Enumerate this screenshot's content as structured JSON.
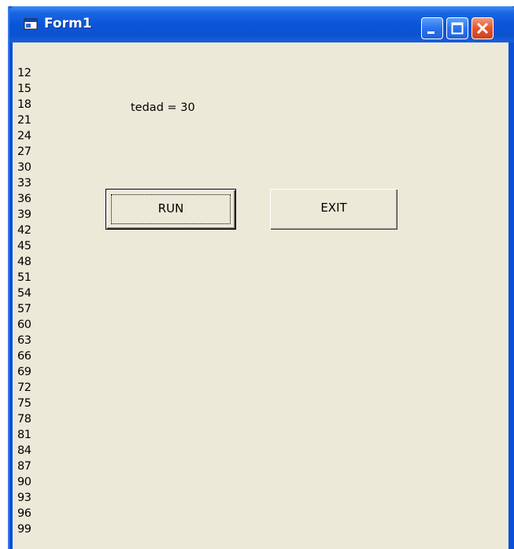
{
  "window": {
    "title": "Form1"
  },
  "output": {
    "numbers": [
      "12",
      "15",
      "18",
      "21",
      "24",
      "27",
      "30",
      "33",
      "36",
      "39",
      "42",
      "45",
      "48",
      "51",
      "54",
      "57",
      "60",
      "63",
      "66",
      "69",
      "72",
      "75",
      "78",
      "81",
      "84",
      "87",
      "90",
      "93",
      "96",
      "99"
    ]
  },
  "label": {
    "text": "tedad = 30"
  },
  "buttons": {
    "run": "RUN",
    "exit": "EXIT"
  },
  "colors": {
    "titlebar": "#0a55d8",
    "client": "#ece9d8",
    "close": "#e4562f"
  },
  "icons": {
    "app": "form-window-icon",
    "minimize": "minimize-icon",
    "maximize": "maximize-icon",
    "close": "close-icon"
  }
}
